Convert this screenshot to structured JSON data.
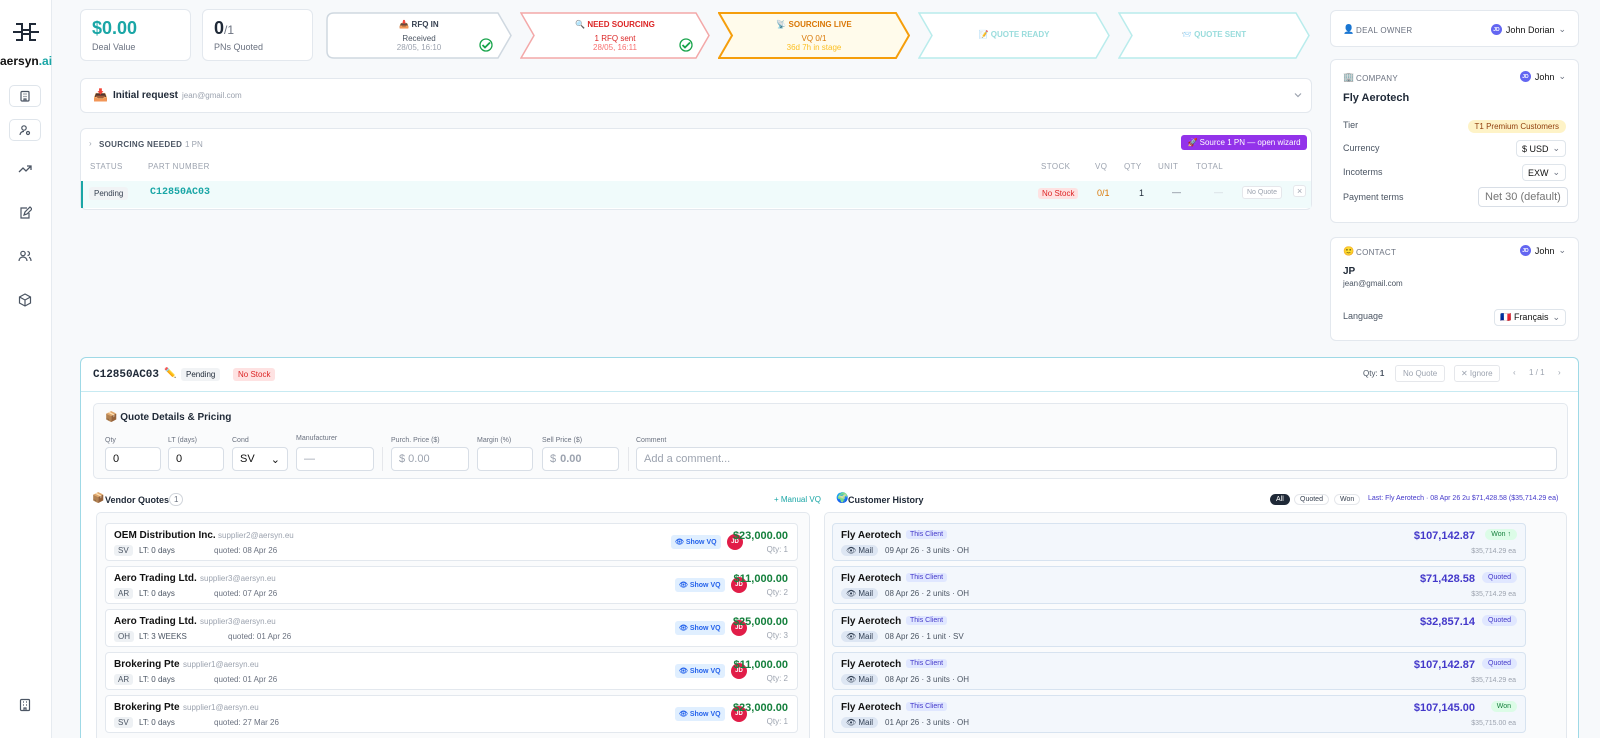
{
  "brand": {
    "name": "aersyn",
    "suffix": ".ai",
    "accent": "#1aa6a6"
  },
  "nav_icons": [
    "building-icon",
    "user-settings-icon",
    "trending-up-icon",
    "edit-document-icon",
    "users-icon",
    "box-icon",
    "building-bottom-icon"
  ],
  "stats": {
    "deal_value": {
      "value": "$0.00",
      "label": "Deal Value"
    },
    "pns_quoted": {
      "value": "0",
      "total": "/1",
      "label": "PNs Quoted"
    }
  },
  "pipeline": [
    {
      "icon": "📥",
      "title": "RFQ IN",
      "line1": "Received",
      "line2": "28/05, 16:10",
      "state": "done"
    },
    {
      "icon": "🔍",
      "title": "NEED SOURCING",
      "line1": "1 RFQ sent",
      "line2": "28/05, 16:11",
      "state": "done"
    },
    {
      "icon": "📡",
      "title": "SOURCING LIVE",
      "line1": "VQ 0/1",
      "line2": "36d 7h in stage",
      "state": "active"
    },
    {
      "icon": "📝",
      "title": "QUOTE READY",
      "state": "pending"
    },
    {
      "icon": "📨",
      "title": "QUOTE SENT",
      "state": "pending"
    }
  ],
  "initial_request": {
    "icon": "📥",
    "title": "Initial request",
    "email": "jean@gmail.com"
  },
  "sourcing": {
    "header": "SOURCING NEEDED",
    "count": "1 PN",
    "wizard_button": "🚀 Source 1 PN — open wizard",
    "columns": {
      "status": "STATUS",
      "part": "PART NUMBER",
      "stock": "STOCK",
      "vq": "VQ",
      "qty": "QTY",
      "unit": "UNIT",
      "total": "TOTAL"
    },
    "row": {
      "status": "Pending",
      "part": "C12850AC03",
      "stock": "No Stock",
      "vq": "0/1",
      "qty": "1",
      "unit": "—",
      "total": "—",
      "action": "No Quote",
      "close": "×"
    }
  },
  "right_panel": {
    "deal_owner": {
      "label": "DEAL OWNER",
      "initials": "JD",
      "name": "John Dorian"
    },
    "company": {
      "label": "COMPANY",
      "initials": "JD",
      "owner": "John",
      "name": "Fly Aerotech",
      "tier_label": "Tier",
      "tier": "T1 Premium Customers",
      "currency_label": "Currency",
      "currency": "$ USD",
      "incoterms_label": "Incoterms",
      "incoterms": "EXW",
      "payment_label": "Payment terms",
      "payment_placeholder": "Net 30 (default)"
    },
    "contact": {
      "label": "CONTACT",
      "initials": "JD",
      "owner": "John",
      "name": "JP",
      "email": "jean@gmail.com",
      "language_label": "Language",
      "language": "🇫🇷 Français"
    }
  },
  "detail": {
    "part": "C12850AC03",
    "edit_icon": "✏️",
    "status": "Pending",
    "stock": "No Stock",
    "qty_label": "Qty:",
    "qty": "1",
    "no_quote": "No Quote",
    "ignore": "✕ Ignore",
    "pager": "1 / 1",
    "quote": {
      "title": "📦 Quote Details & Pricing",
      "fields": {
        "qty": {
          "label": "Qty",
          "value": "0"
        },
        "lt": {
          "label": "LT (days)",
          "value": "0"
        },
        "cond": {
          "label": "Cond",
          "value": "SV"
        },
        "manufacturer": {
          "label": "Manufacturer",
          "placeholder": "—"
        },
        "purch": {
          "label": "Purch. Price ($)",
          "placeholder": "$ 0.00"
        },
        "margin": {
          "label": "Margin (%)",
          "placeholder": ""
        },
        "sell": {
          "label": "Sell Price ($)",
          "prefix": "$",
          "value": "0.00"
        },
        "comment": {
          "label": "Comment",
          "placeholder": "Add a comment..."
        }
      }
    },
    "vendor_quotes": {
      "title": "Vendor Quotes",
      "icon": "📦",
      "count": "1",
      "manual_link": "+ Manual VQ",
      "show_vq": "👁 Show VQ",
      "owner_initials": "JD",
      "rows": [
        {
          "name": "OEM Distribution Inc.",
          "email": "supplier2@aersyn.eu",
          "cond": "SV",
          "lt": "LT: 0 days",
          "quoted": "quoted: 08 Apr 26",
          "price": "$23,000.00",
          "qty": "Qty: 1"
        },
        {
          "name": "Aero Trading Ltd.",
          "email": "supplier3@aersyn.eu",
          "cond": "AR",
          "lt": "LT: 0 days",
          "quoted": "quoted: 07 Apr 26",
          "price": "$11,000.00",
          "qty": "Qty: 2"
        },
        {
          "name": "Aero Trading Ltd.",
          "email": "supplier3@aersyn.eu",
          "cond": "OH",
          "lt": "LT: 3 WEEKS",
          "quoted": "quoted: 01 Apr 26",
          "price": "$25,000.00",
          "qty": "Qty: 3"
        },
        {
          "name": "Brokering Pte",
          "email": "supplier1@aersyn.eu",
          "cond": "AR",
          "lt": "LT: 0 days",
          "quoted": "quoted: 01 Apr 26",
          "price": "$11,000.00",
          "qty": "Qty: 2"
        },
        {
          "name": "Brokering Pte",
          "email": "supplier1@aersyn.eu",
          "cond": "SV",
          "lt": "LT: 0 days",
          "quoted": "quoted: 27 Mar 26",
          "price": "$23,000.00",
          "qty": "Qty: 1"
        }
      ]
    },
    "customer_history": {
      "title": "Customer History",
      "icon": "🌍",
      "filters": [
        "All",
        "Quoted",
        "Won"
      ],
      "last": "Last: Fly Aerotech · 08 Apr 26 2u $71,428.58 ($35,714.29 ea)",
      "client_badge": "This Client",
      "mail_label": "👁 Mail",
      "rows": [
        {
          "name": "Fly Aerotech",
          "date": "09 Apr 26",
          "units": "3 units",
          "cond": "OH",
          "price": "$107,142.87",
          "status": "Won ↑",
          "each": "$35,714.29 ea"
        },
        {
          "name": "Fly Aerotech",
          "date": "08 Apr 26",
          "units": "2 units",
          "cond": "OH",
          "price": "$71,428.58",
          "status": "Quoted",
          "each": "$35,714.29 ea"
        },
        {
          "name": "Fly Aerotech",
          "date": "08 Apr 26",
          "units": "1 unit",
          "cond": "SV",
          "price": "$32,857.14",
          "status": "Quoted",
          "each": ""
        },
        {
          "name": "Fly Aerotech",
          "date": "08 Apr 26",
          "units": "3 units",
          "cond": "OH",
          "price": "$107,142.87",
          "status": "Quoted",
          "each": "$35,714.29 ea"
        },
        {
          "name": "Fly Aerotech",
          "date": "01 Apr 26",
          "units": "3 units",
          "cond": "OH",
          "price": "$107,145.00",
          "status": "Won",
          "each": "$35,715.00 ea"
        }
      ]
    }
  },
  "colors": {
    "accent": "#1aa6a6",
    "active_stage": "#f59e0b",
    "done_stage": "#f3a8a8",
    "won": "#15803d",
    "quoted": "#4338ca",
    "danger": "#e11d48",
    "wizard": "#9333ea"
  }
}
